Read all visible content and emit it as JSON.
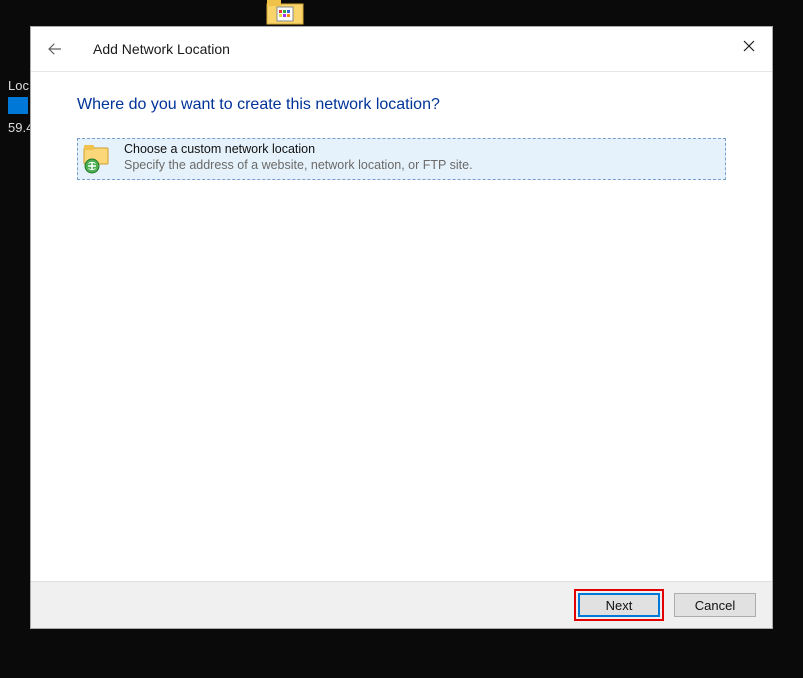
{
  "background": {
    "loc_label": "Loc",
    "value_label": "59.4"
  },
  "dialog": {
    "title": "Add Network Location",
    "heading": "Where do you want to create this network location?",
    "option": {
      "title": "Choose a custom network location",
      "description": "Specify the address of a website, network location, or FTP site."
    },
    "buttons": {
      "next": "Next",
      "cancel": "Cancel"
    }
  }
}
